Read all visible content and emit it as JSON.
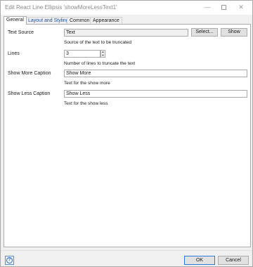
{
  "window": {
    "title": "Edit React Line Ellipsis 'showMoreLessText1'",
    "minimize_glyph": "—",
    "close_glyph": "✕"
  },
  "tabs": [
    {
      "label": "General",
      "active": true
    },
    {
      "label": "Layout and Styling",
      "active": false
    },
    {
      "label": "Common",
      "active": false
    },
    {
      "label": "Appearance",
      "active": false
    }
  ],
  "form": {
    "text_source": {
      "label": "Text Source",
      "value": "Text",
      "select_label": "Select...",
      "show_label": "Show",
      "hint": "Source of the text to be truncated"
    },
    "lines": {
      "label": "Lines",
      "value": "3",
      "hint": "Number of lines to truncate the text"
    },
    "show_more": {
      "label": "Show More Caption",
      "value": "Show More",
      "hint": "Text for the show more"
    },
    "show_less": {
      "label": "Show Less Caption",
      "value": "Show Less",
      "hint": "Text for the show less"
    }
  },
  "footer": {
    "help_glyph": "?",
    "ok_label": "OK",
    "cancel_label": "Cancel"
  },
  "icons": {
    "spin_up": "▲",
    "spin_down": "▼"
  },
  "colors": {
    "dialog_bg": "#f0f0f0",
    "panel_bg": "#ffffff",
    "active_tab_text": "#1f4fa3",
    "ok_border": "#2f7ad8"
  }
}
